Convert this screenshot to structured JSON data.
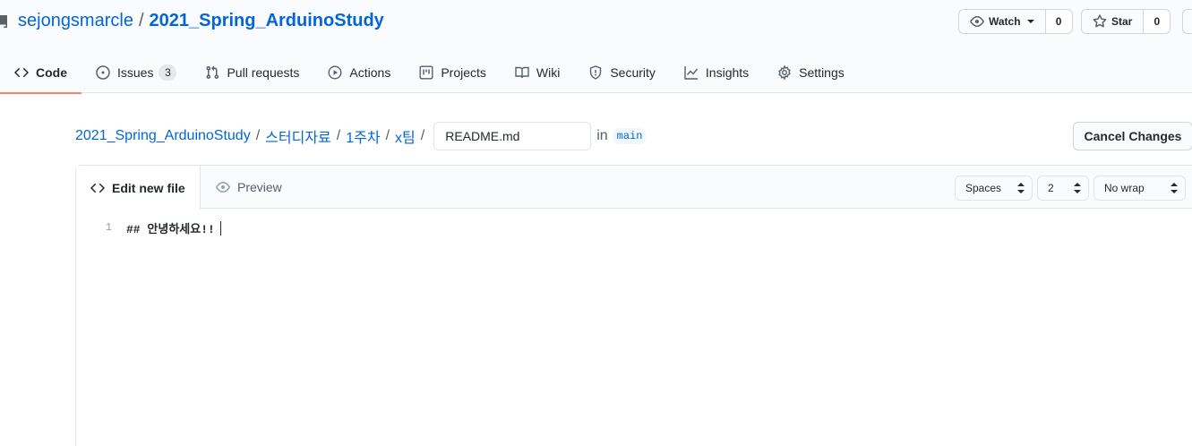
{
  "repo": {
    "owner": "sejongsmarcle",
    "separator": "/",
    "name": "2021_Spring_ArduinoStudy"
  },
  "repo_actions": {
    "watch_label": "Watch",
    "watch_count": "0",
    "star_label": "Star",
    "star_count": "0"
  },
  "nav_tabs": [
    {
      "label": "Code",
      "icon": "code-icon",
      "selected": true
    },
    {
      "label": "Issues",
      "icon": "issue-icon",
      "badge": "3"
    },
    {
      "label": "Pull requests",
      "icon": "pull-request-icon"
    },
    {
      "label": "Actions",
      "icon": "play-icon"
    },
    {
      "label": "Projects",
      "icon": "project-icon"
    },
    {
      "label": "Wiki",
      "icon": "book-icon"
    },
    {
      "label": "Security",
      "icon": "shield-icon"
    },
    {
      "label": "Insights",
      "icon": "graph-icon"
    },
    {
      "label": "Settings",
      "icon": "gear-icon"
    }
  ],
  "breadcrumb": {
    "items": [
      "2021_Spring_ArduinoStudy",
      "스터디자료",
      "1주차",
      "x팀"
    ],
    "separator": "/",
    "filename": "README.md",
    "in_label": "in",
    "branch": "main"
  },
  "cancel_label": "Cancel Changes",
  "editor": {
    "tab_edit": "Edit new file",
    "tab_preview": "Preview",
    "indent_mode": "Spaces",
    "indent_size": "2",
    "wrap_mode": "No wrap",
    "lines": [
      {
        "number": "1",
        "text": "## 안녕하세요!!"
      }
    ]
  },
  "colors": {
    "link": "#0366d6",
    "tab_underline": "#f9826c",
    "border": "#e1e4e8"
  }
}
